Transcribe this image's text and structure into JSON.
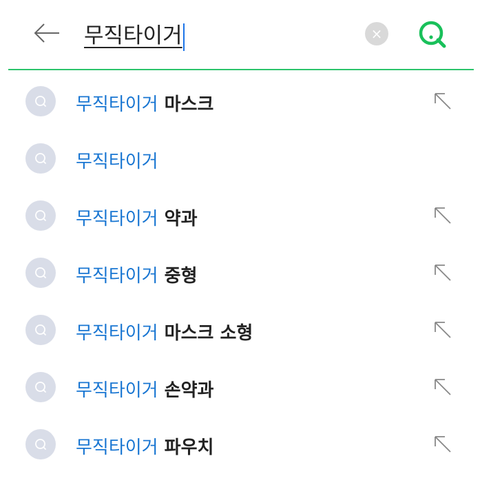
{
  "search": {
    "query": "무직타이거",
    "clear_icon": "×"
  },
  "colors": {
    "accent_green": "#2bc46b",
    "match_blue": "#1976d2"
  },
  "icons": {
    "back": "back-arrow-icon",
    "clear": "clear-icon",
    "search": "search-icon",
    "suggestion": "search-history-icon",
    "fill": "arrow-up-left-icon"
  },
  "suggestions": [
    {
      "match": "무직타이거",
      "rest": " 마스크",
      "fill_arrow": true
    },
    {
      "match": "무직타이거",
      "rest": "",
      "fill_arrow": false
    },
    {
      "match": "무직타이거",
      "rest": " 약과",
      "fill_arrow": true
    },
    {
      "match": "무직타이거",
      "rest": " 중형",
      "fill_arrow": true
    },
    {
      "match": "무직타이거",
      "rest": " 마스크 소형",
      "fill_arrow": true
    },
    {
      "match": "무직타이거",
      "rest": " 손약과",
      "fill_arrow": true
    },
    {
      "match": "무직타이거",
      "rest": " 파우치",
      "fill_arrow": true
    }
  ]
}
